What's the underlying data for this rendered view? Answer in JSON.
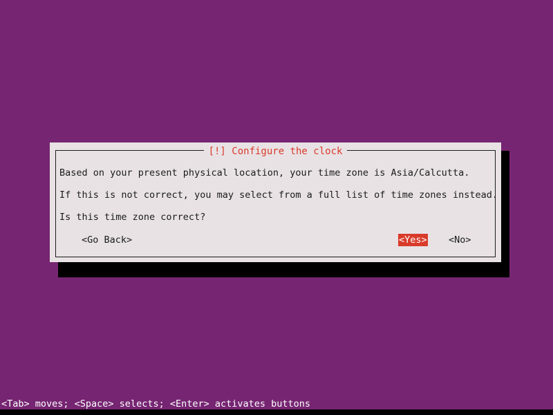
{
  "screen": {
    "background_color": "#762572",
    "kind": "debian-installer-newt-dialog"
  },
  "dialog": {
    "title": "[!] Configure the clock",
    "title_color": "#d93b2b",
    "background_color": "#e8e2e5",
    "border_color": "#1a1a1a",
    "shadow_color": "#000000",
    "body_lines": [
      "Based on your present physical location, your time zone is Asia/Calcutta.",
      "If this is not correct, you may select from a full list of time zones instead.",
      "Is this time zone correct?"
    ],
    "detected_time_zone": "Asia/Calcutta",
    "buttons": [
      {
        "label": "<Go Back>",
        "name": "go-back",
        "selected": false
      },
      {
        "label": "<Yes>",
        "name": "yes",
        "selected": true
      },
      {
        "label": "<No>",
        "name": "no",
        "selected": false
      }
    ],
    "selected_button": "<Yes>",
    "selected_button_bg": "#d93b2b",
    "selected_button_fg": "#ffffff"
  },
  "help_bar": {
    "text": "<Tab> moves; <Space> selects; <Enter> activates buttons",
    "text_color": "#ffffff",
    "background_color": "#762572"
  }
}
